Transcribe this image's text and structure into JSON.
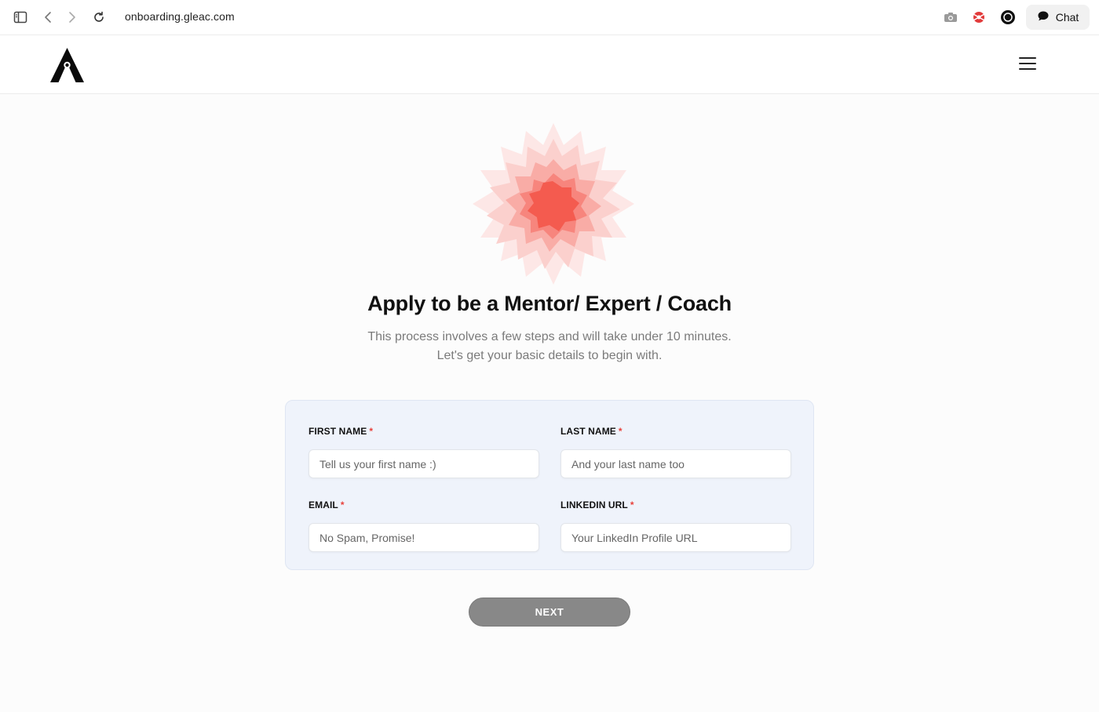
{
  "browser": {
    "url": "onboarding.gleac.com",
    "chat_label": "Chat",
    "icons": [
      "sidebar-toggle-icon",
      "back-arrow-icon",
      "forward-arrow-icon",
      "reload-icon",
      "camera-icon",
      "extension-icon",
      "circle-extension-icon",
      "chat-bubble-icon"
    ]
  },
  "header": {
    "logo_alt": "A",
    "menu_icon": "hamburger-menu-icon"
  },
  "hero": {
    "title": "Apply to be a Mentor/ Expert / Coach",
    "subtitle_line1": "This process involves a few steps and will take under 10 minutes.",
    "subtitle_line2": "Let's get your basic details to begin with."
  },
  "form": {
    "first_name": {
      "label": "FIRST NAME",
      "required_mark": "*",
      "placeholder": "Tell us your first name :)",
      "value": ""
    },
    "last_name": {
      "label": "LAST NAME",
      "required_mark": "*",
      "placeholder": "And your last name too",
      "value": ""
    },
    "email": {
      "label": "EMAIL",
      "required_mark": "*",
      "placeholder": "No Spam, Promise!",
      "value": ""
    },
    "linkedin": {
      "label": "LINKEDIN URL",
      "required_mark": "*",
      "placeholder": "Your LinkedIn Profile URL",
      "value": ""
    },
    "next_label": "NEXT"
  },
  "colors": {
    "accent_red": "#e8403a",
    "button_disabled": "#888888",
    "card_bg": "#eff3fb"
  }
}
